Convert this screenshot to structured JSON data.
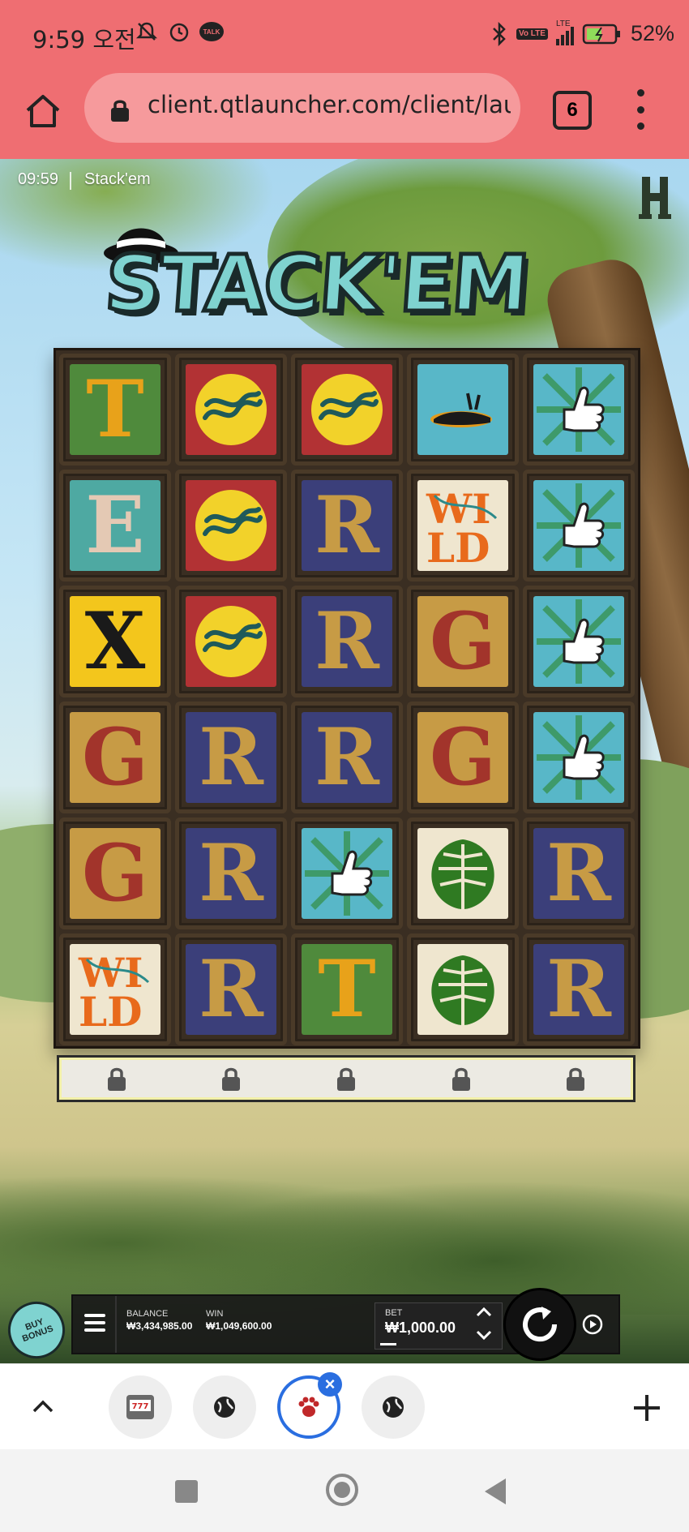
{
  "status_bar": {
    "time": "9:59 오전",
    "talk_badge": "TALK",
    "volte": "Vo LTE",
    "lte": "LTE",
    "battery": "52%",
    "icons": [
      "mute-icon",
      "alarm-icon",
      "kakaotalk-icon",
      "bluetooth-icon",
      "volte-icon",
      "signal-icon",
      "battery-charging-icon"
    ]
  },
  "browser": {
    "url": "client.qtlauncher.com/client/launch",
    "tab_count": "6",
    "icons": [
      "home-icon",
      "lock-icon",
      "more-menu-icon"
    ]
  },
  "game": {
    "time": "09:59",
    "title": "Stack'em",
    "logo_text": "STACK'EM",
    "reels": [
      [
        {
          "sym": "T",
          "bg": "green",
          "fg": "#e8a21a"
        },
        {
          "sym": "snake",
          "bg": "red"
        },
        {
          "sym": "snake",
          "bg": "red"
        },
        {
          "sym": "bird",
          "bg": "sky"
        },
        {
          "sym": "thumb",
          "bg": "sky"
        }
      ],
      [
        {
          "sym": "E",
          "bg": "teal",
          "fg": "#e4c9b4"
        },
        {
          "sym": "snake",
          "bg": "red"
        },
        {
          "sym": "R",
          "bg": "navy",
          "fg": "#c79b45"
        },
        {
          "sym": "WILD",
          "bg": "cream"
        },
        {
          "sym": "thumb",
          "bg": "sky"
        }
      ],
      [
        {
          "sym": "X",
          "bg": "yellow",
          "fg": "#1a1a1a"
        },
        {
          "sym": "snake",
          "bg": "red"
        },
        {
          "sym": "R",
          "bg": "navy",
          "fg": "#c79b45"
        },
        {
          "sym": "G",
          "bg": "tan",
          "fg": "#a2342b"
        },
        {
          "sym": "thumb",
          "bg": "sky"
        }
      ],
      [
        {
          "sym": "G",
          "bg": "tan",
          "fg": "#a2342b"
        },
        {
          "sym": "R",
          "bg": "navy",
          "fg": "#c79b45"
        },
        {
          "sym": "R",
          "bg": "navy",
          "fg": "#c79b45"
        },
        {
          "sym": "G",
          "bg": "tan",
          "fg": "#a2342b"
        },
        {
          "sym": "thumb",
          "bg": "sky"
        }
      ],
      [
        {
          "sym": "G",
          "bg": "tan",
          "fg": "#a2342b"
        },
        {
          "sym": "R",
          "bg": "navy",
          "fg": "#c79b45"
        },
        {
          "sym": "thumb",
          "bg": "sky"
        },
        {
          "sym": "leaf",
          "bg": "cream"
        },
        {
          "sym": "R",
          "bg": "navy",
          "fg": "#c79b45"
        }
      ],
      [
        {
          "sym": "WILD",
          "bg": "cream"
        },
        {
          "sym": "R",
          "bg": "navy",
          "fg": "#c79b45"
        },
        {
          "sym": "T",
          "bg": "green",
          "fg": "#e8a21a"
        },
        {
          "sym": "leaf",
          "bg": "cream"
        },
        {
          "sym": "R",
          "bg": "navy",
          "fg": "#c79b45"
        }
      ]
    ],
    "locked_columns": 5
  },
  "hud": {
    "buy_bonus": "BUY BONUS",
    "balance_label": "BALANCE",
    "balance_value": "₩3,434,985.00",
    "win_label": "WIN",
    "win_value": "₩1,049,600.00",
    "bet_label": "BET",
    "bet_value": "₩1,000.00"
  },
  "tab_strip": {
    "tabs": [
      "slot-777-icon",
      "globe-icon",
      "paw-icon",
      "globe-icon"
    ],
    "active_index": 2
  },
  "colors": {
    "chrome": "#ef6e72",
    "accent": "#2a6ee0",
    "logo": "#7fd3d0"
  }
}
